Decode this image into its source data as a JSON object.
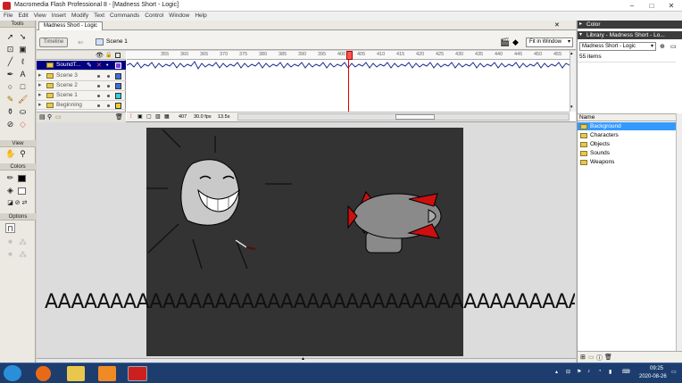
{
  "app": {
    "title": "Macromedia Flash Professional 8 - [Madness Short - Logic]",
    "window_buttons": [
      "–",
      "□",
      "✕"
    ]
  },
  "menu": [
    "File",
    "Edit",
    "View",
    "Insert",
    "Modify",
    "Text",
    "Commands",
    "Control",
    "Window",
    "Help"
  ],
  "tools_panel": {
    "title": "Tools",
    "view_label": "View",
    "colors_label": "Colors",
    "options_label": "Options"
  },
  "document": {
    "tab": "Madness Short - Logic",
    "timeline_button": "Timeline",
    "scene": "Scene 1",
    "zoom": "Fit in Window"
  },
  "timeline": {
    "layers": [
      {
        "name": "SoundT...",
        "color": "#7a3fd6",
        "selected": true
      },
      {
        "name": "Scene 3",
        "color": "#3b6fe0",
        "selected": false
      },
      {
        "name": "Scene 2",
        "color": "#3b6fe0",
        "selected": false
      },
      {
        "name": "Scene 1",
        "color": "#2fd0e0",
        "selected": false
      },
      {
        "name": "Beginning",
        "color": "#e8d040",
        "selected": false
      }
    ],
    "ruler": [
      "355",
      "360",
      "365",
      "370",
      "375",
      "380",
      "385",
      "390",
      "395",
      "400",
      "405",
      "410",
      "415",
      "420",
      "425",
      "430",
      "435",
      "440",
      "445",
      "450",
      "455",
      "460"
    ],
    "frame": "407",
    "fps": "30.0 fps",
    "time": "13.5s"
  },
  "stage": {
    "banner_text": "AAAAAAAAAAAAAAAAAAAAAAAAAAAAAAAAAAAAAAAAAAAAAAAAAAAAA."
  },
  "right_panel": {
    "color_header": "Color",
    "library_header": "Library - Madness Short - Lo...",
    "library_select": "Madness Short - Logic",
    "item_count": "55 items",
    "column_header": "Name",
    "items": [
      {
        "name": "Background",
        "selected": true
      },
      {
        "name": "Characters",
        "selected": false
      },
      {
        "name": "Objects",
        "selected": false
      },
      {
        "name": "Sounds",
        "selected": false
      },
      {
        "name": "Weapons",
        "selected": false
      }
    ]
  },
  "taskbar": {
    "time": "09:25",
    "date": "2020-08-26"
  },
  "colors": {
    "stage_bg": "#333333",
    "accent_selection": "#3399ff",
    "playhead": "#dd0000",
    "taskbar": "#1c3d6e"
  }
}
